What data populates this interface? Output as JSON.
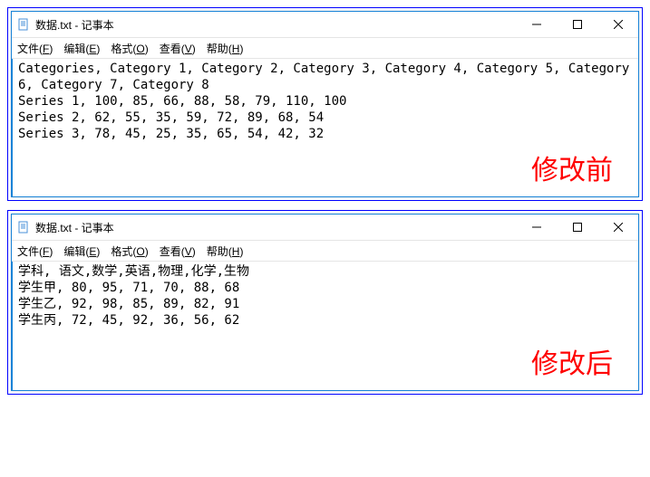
{
  "top": {
    "title": "数据.txt - 记事本",
    "caption": "修改前",
    "content": "Categories, Category 1, Category 2, Category 3, Category 4, Category 5, Category 6, Category 7, Category 8\nSeries 1, 100, 85, 66, 88, 58, 79, 110, 100\nSeries 2, 62, 55, 35, 59, 72, 89, 68, 54\nSeries 3, 78, 45, 25, 35, 65, 54, 42, 32"
  },
  "bottom": {
    "title": "数据.txt - 记事本",
    "caption": "修改后",
    "content": "学科, 语文,数学,英语,物理,化学,生物\n学生甲, 80, 95, 71, 70, 88, 68\n学生乙, 92, 98, 85, 89, 82, 91\n学生丙, 72, 45, 92, 36, 56, 62"
  },
  "menu": {
    "file": "文件",
    "file_accel": "F",
    "edit": "编辑",
    "edit_accel": "E",
    "format": "格式",
    "format_accel": "O",
    "view": "查看",
    "view_accel": "V",
    "help": "帮助",
    "help_accel": "H"
  },
  "chart_data": [
    {
      "type": "table",
      "title": "修改前",
      "categories": [
        "Category 1",
        "Category 2",
        "Category 3",
        "Category 4",
        "Category 5",
        "Category 6",
        "Category 7",
        "Category 8"
      ],
      "series": [
        {
          "name": "Series 1",
          "values": [
            100,
            85,
            66,
            88,
            58,
            79,
            110,
            100
          ]
        },
        {
          "name": "Series 2",
          "values": [
            62,
            55,
            35,
            59,
            72,
            89,
            68,
            54
          ]
        },
        {
          "name": "Series 3",
          "values": [
            78,
            45,
            25,
            35,
            65,
            54,
            42,
            32
          ]
        }
      ]
    },
    {
      "type": "table",
      "title": "修改后",
      "categories": [
        "语文",
        "数学",
        "英语",
        "物理",
        "化学",
        "生物"
      ],
      "series": [
        {
          "name": "学生甲",
          "values": [
            80,
            95,
            71,
            70,
            88,
            68
          ]
        },
        {
          "name": "学生乙",
          "values": [
            92,
            98,
            85,
            89,
            82,
            91
          ]
        },
        {
          "name": "学生丙",
          "values": [
            72,
            45,
            92,
            36,
            56,
            62
          ]
        }
      ]
    }
  ]
}
